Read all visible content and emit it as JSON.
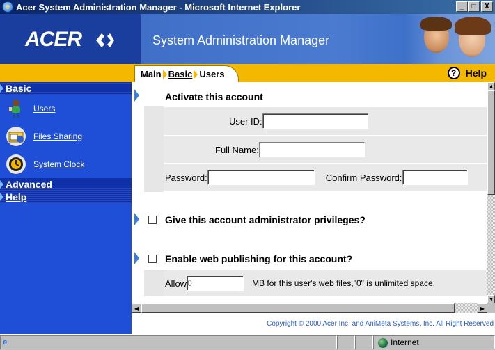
{
  "window": {
    "title": "Acer System Administration Manager - Microsoft Internet Explorer",
    "buttons": {
      "minimize": "_",
      "maximize": "□",
      "close": "X"
    }
  },
  "banner": {
    "logo": "ACER",
    "title": "System Administration Manager"
  },
  "breadcrumb": {
    "main": "Main",
    "basic": "Basic",
    "users": "Users"
  },
  "help": {
    "label": "Help",
    "icon": "question-icon"
  },
  "sidebar": {
    "sections": [
      {
        "label": "Basic"
      },
      {
        "label": "Advanced"
      },
      {
        "label": "Help"
      }
    ],
    "items": [
      {
        "label": "Users",
        "icon": "users-icon"
      },
      {
        "label": "Files Sharing",
        "icon": "folder-share-icon"
      },
      {
        "label": "System Clock",
        "icon": "clock-icon"
      }
    ]
  },
  "form": {
    "activate_title": "Activate this account",
    "user_id_label": "User ID:",
    "user_id_value": "",
    "full_name_label": "Full Name:",
    "full_name_value": "",
    "password_label": "Password:",
    "confirm_password_label": "Confirm Password:",
    "admin_label": "Give this account administrator privileges?",
    "admin_checked": false,
    "web_label": "Enable web publishing for this account?",
    "web_checked": false,
    "allow_label": "Allow",
    "allow_placeholder": "0",
    "allow_suffix": "MB for this user's web files,\"0\" is unlimited space."
  },
  "footer": {
    "copyright": "Copyright © 2000   Acer Inc. and AniMeta Systems, Inc.   All Right Reserved"
  },
  "statusbar": {
    "zone": "Internet"
  },
  "colors": {
    "titlebar": "#0a246a",
    "banner": "#1a3e9e",
    "nav_strip": "#f5b800",
    "sidebar": "#1f4fd6",
    "copyright_text": "#2a5ec9"
  }
}
